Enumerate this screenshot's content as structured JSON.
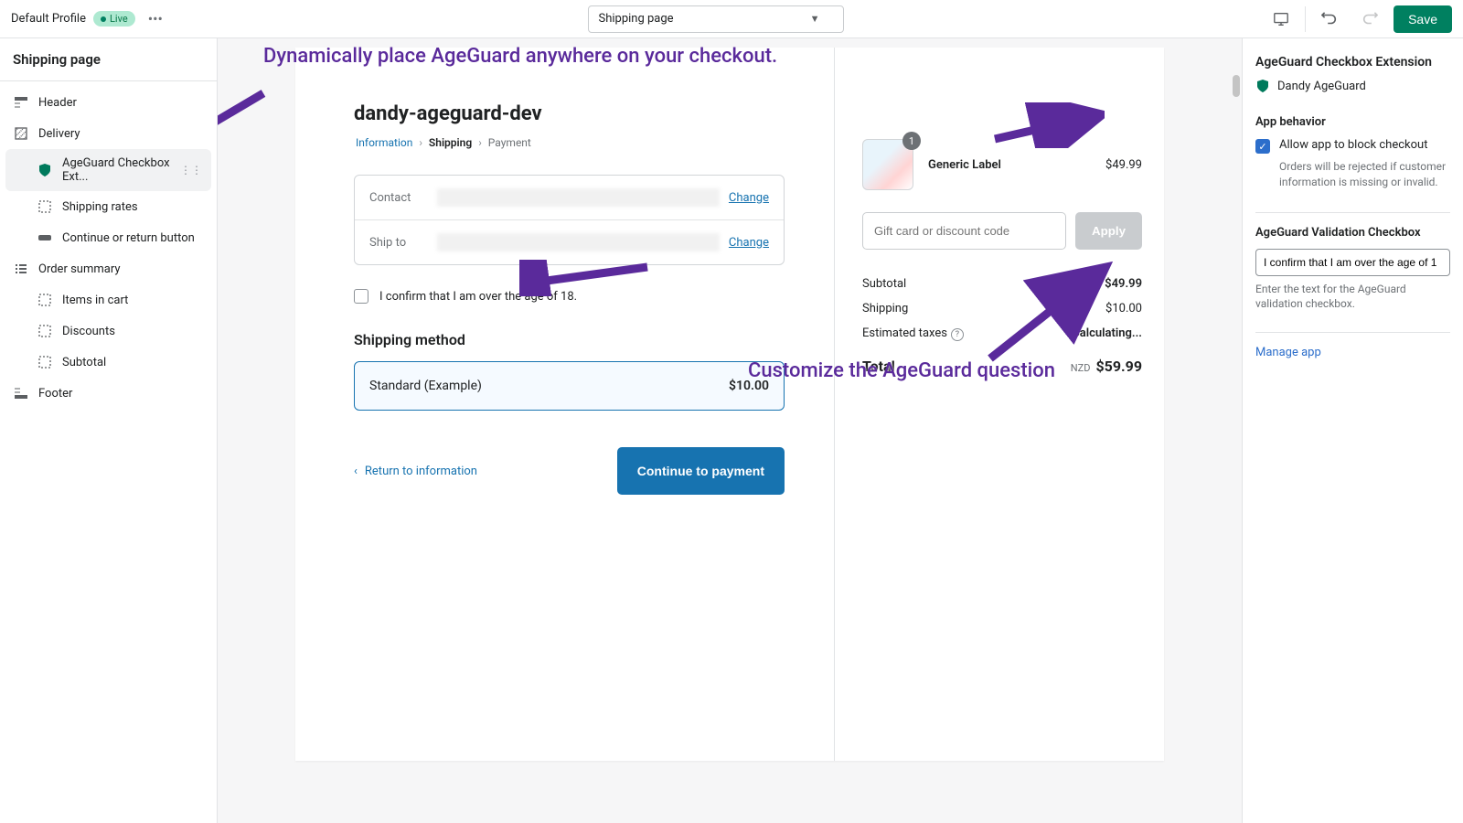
{
  "topbar": {
    "profile": "Default Profile",
    "live": "Live",
    "page_selector": "Shipping page",
    "save": "Save"
  },
  "sidebar": {
    "title": "Shipping page",
    "items": [
      {
        "label": "Header"
      },
      {
        "label": "Delivery"
      },
      {
        "label": "AgeGuard Checkbox Ext..."
      },
      {
        "label": "Shipping rates"
      },
      {
        "label": "Continue or return button"
      },
      {
        "label": "Order summary"
      },
      {
        "label": "Items in cart"
      },
      {
        "label": "Discounts"
      },
      {
        "label": "Subtotal"
      },
      {
        "label": "Footer"
      }
    ]
  },
  "checkout": {
    "store_name": "dandy-ageguard-dev",
    "breadcrumb": {
      "info": "Information",
      "shipping": "Shipping",
      "payment": "Payment"
    },
    "contact_label": "Contact",
    "shipto_label": "Ship to",
    "change": "Change",
    "confirm_text": "I confirm that I am over the age of 18.",
    "shipping_method_title": "Shipping method",
    "shipping_option": "Standard (Example)",
    "shipping_option_price": "$10.00",
    "return": "Return to information",
    "continue": "Continue to payment"
  },
  "cart": {
    "item_name": "Generic Label",
    "item_qty": "1",
    "item_price": "$49.99",
    "discount_placeholder": "Gift card or discount code",
    "apply": "Apply",
    "subtotal_label": "Subtotal",
    "subtotal": "$49.99",
    "shipping_label": "Shipping",
    "shipping": "$10.00",
    "tax_label": "Estimated taxes",
    "tax": "Calculating...",
    "total_label": "Total",
    "currency": "NZD",
    "total": "$59.99"
  },
  "rightpanel": {
    "title": "AgeGuard Checkbox Extension",
    "app_name": "Dandy AgeGuard",
    "behavior_title": "App behavior",
    "allow_block": "Allow app to block checkout",
    "allow_block_help": "Orders will be rejected if customer information is missing or invalid.",
    "validation_title": "AgeGuard Validation Checkbox",
    "validation_value": "I confirm that I am over the age of 1",
    "validation_help": "Enter the text for the AgeGuard validation checkbox.",
    "manage": "Manage app"
  },
  "annotations": {
    "a1": "Dynamically place AgeGuard anywhere on your checkout.",
    "a2": "Customize the AgeGuard question"
  }
}
